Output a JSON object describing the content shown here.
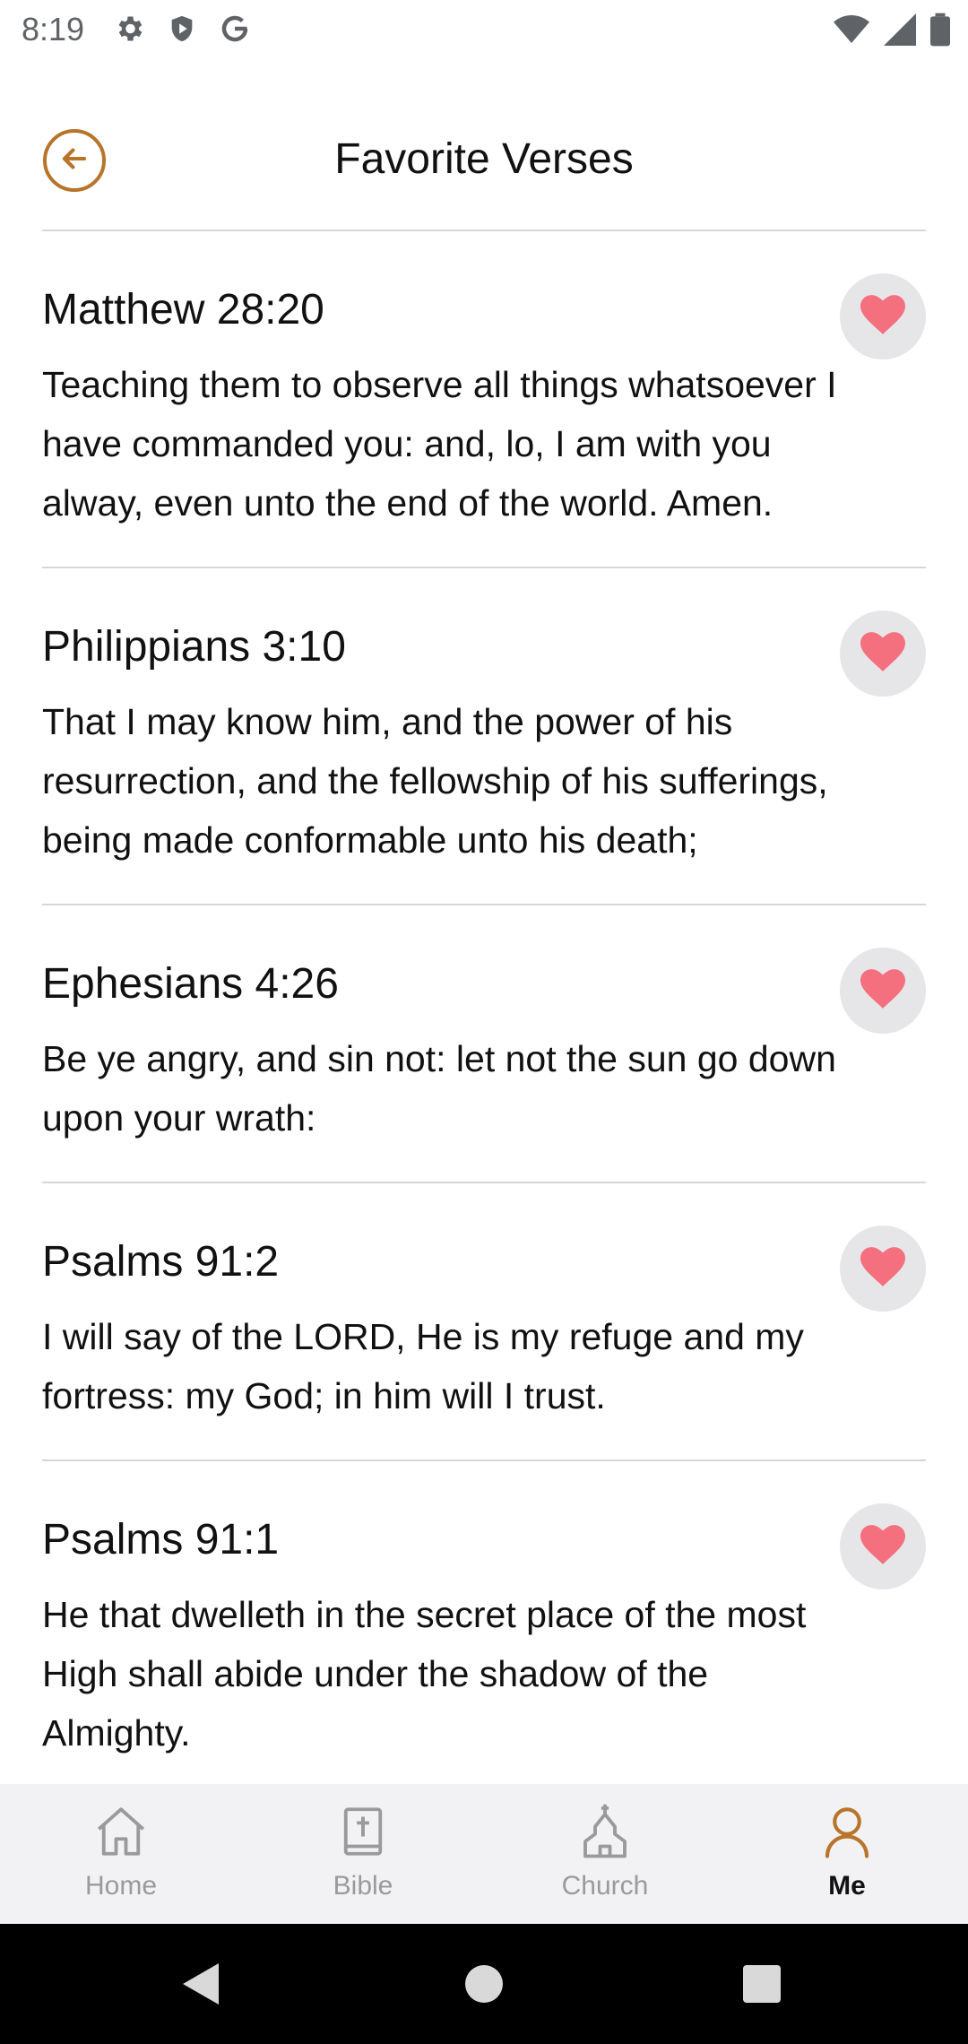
{
  "status_bar": {
    "time": "8:19",
    "left_icons": [
      "settings-gear-icon",
      "shield-icon",
      "google-g-icon"
    ],
    "right_icons": [
      "wifi-icon",
      "cell-signal-icon",
      "battery-icon"
    ]
  },
  "header": {
    "title": "Favorite Verses",
    "back_icon": "back-arrow-icon",
    "accent_color": "#b8742a"
  },
  "verses": [
    {
      "reference": "Matthew 28:20",
      "text": "Teaching them to observe all things whatsoever I have commanded you: and, lo, I am with you alway, even unto the end of the world. Amen.",
      "favorited": true
    },
    {
      "reference": "Philippians 3:10",
      "text": "That I may know him, and the power of his resurrection, and the fellowship of his sufferings, being made conformable unto his death;",
      "favorited": true
    },
    {
      "reference": "Ephesians 4:26",
      "text": "Be ye angry, and sin not: let not the sun go down upon your wrath:",
      "favorited": true
    },
    {
      "reference": "Psalms 91:2",
      "text": "I will say of the LORD, He is my refuge and my fortress: my God; in him will I trust.",
      "favorited": true
    },
    {
      "reference": "Psalms 91:1",
      "text": "He that dwelleth in the secret place of the most High shall abide under the shadow of the Almighty.",
      "favorited": true
    }
  ],
  "heart_color": "#f4707f",
  "bottom_nav": {
    "items": [
      {
        "label": "Home",
        "icon": "home-icon",
        "active": false
      },
      {
        "label": "Bible",
        "icon": "bible-icon",
        "active": false
      },
      {
        "label": "Church",
        "icon": "church-icon",
        "active": false
      },
      {
        "label": "Me",
        "icon": "person-icon",
        "active": true
      }
    ]
  }
}
